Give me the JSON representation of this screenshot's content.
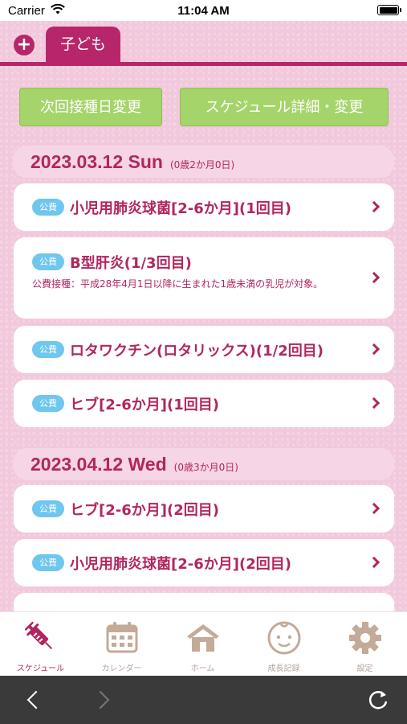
{
  "status_bar": {
    "carrier": "Carrier",
    "time": "11:04 AM"
  },
  "tabs": {
    "add_icon": "plus-icon",
    "child_tab_label": "子ども"
  },
  "actions": {
    "next_vaccination_label": "次回接種日変更",
    "schedule_label": "スケジュール詳細・変更"
  },
  "schedule": [
    {
      "date": "2023.03.12 Sun",
      "age": "(0歳2か月0日)",
      "items": [
        {
          "badge": "公費",
          "title": "小児用肺炎球菌[2-6か月](1回目)"
        },
        {
          "badge": "公費",
          "title": "B型肝炎(1/3回目)",
          "note": "公費接種：平成28年4月1日以降に生まれた1歳未満の乳児が対象。"
        },
        {
          "badge": "公費",
          "title": "ロタワクチン(ロタリックス)(1/2回目)"
        },
        {
          "badge": "公費",
          "title": "ヒブ[2-6か月](1回目)"
        }
      ]
    },
    {
      "date": "2023.04.12 Wed",
      "age": "(0歳3か月0日)",
      "items": [
        {
          "badge": "公費",
          "title": "ヒブ[2-6か月](2回目)"
        },
        {
          "badge": "公費",
          "title": "小児用肺炎球菌[2-6か月](2回目)"
        }
      ]
    }
  ],
  "tab_bar": [
    {
      "label": "スケジュール",
      "icon": "syringe-icon",
      "active": true
    },
    {
      "label": "カレンダー",
      "icon": "calendar-icon",
      "active": false
    },
    {
      "label": "ホーム",
      "icon": "house-icon",
      "active": false
    },
    {
      "label": "成長記録",
      "icon": "baby-face-icon",
      "active": false
    },
    {
      "label": "設定",
      "icon": "gear-icon",
      "active": false
    }
  ],
  "colors": {
    "accent": "#b7266a",
    "button_green": "#a5d46a",
    "badge_blue": "#6fc6ee",
    "background_pink": "#f2c8dc"
  }
}
